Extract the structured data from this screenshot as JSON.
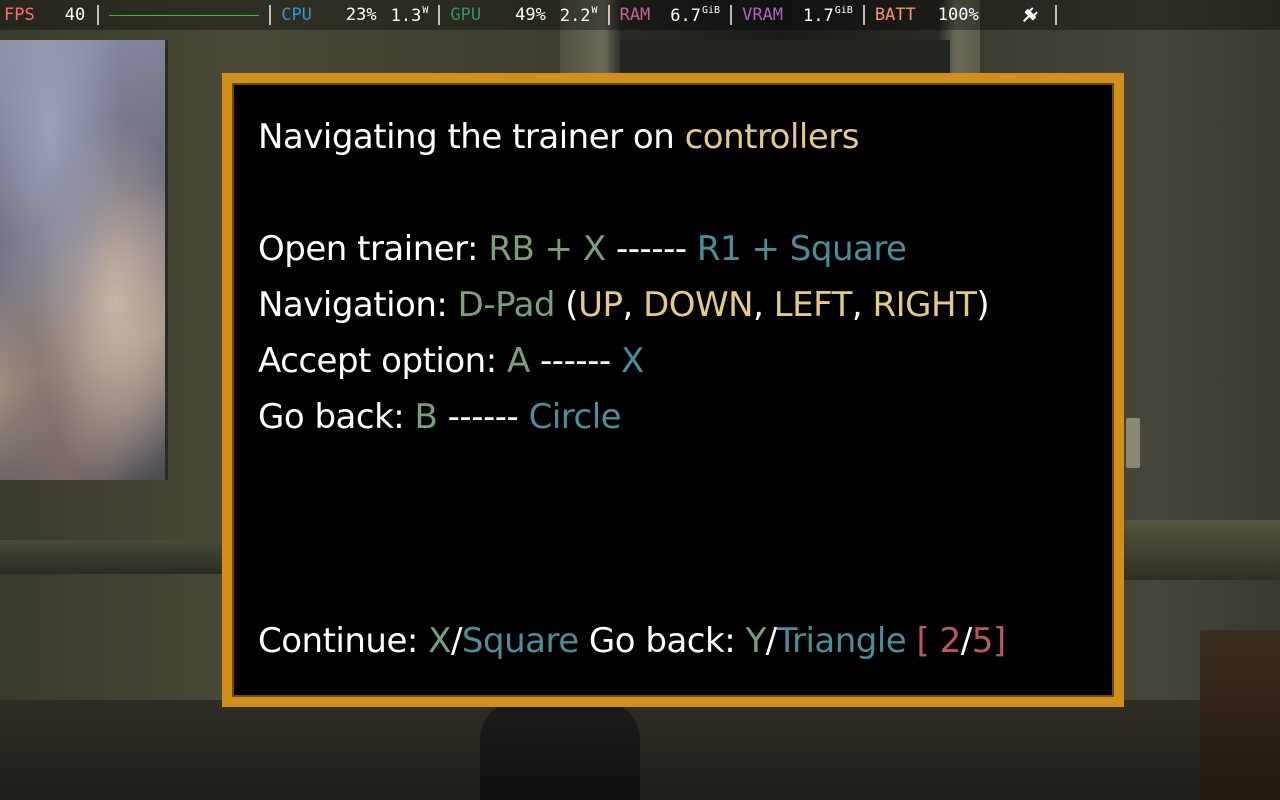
{
  "overlay": {
    "fps_label": "FPS",
    "fps_value": "40",
    "cpu_label": "CPU",
    "cpu_load": "23%",
    "cpu_power": "1.3",
    "cpu_power_unit": "W",
    "gpu_label": "GPU",
    "gpu_load": "49%",
    "gpu_power": "2.2",
    "gpu_power_unit": "W",
    "ram_label": "RAM",
    "ram_value": "6.7",
    "ram_unit": "GiB",
    "vram_label": "VRAM",
    "vram_value": "1.7",
    "vram_unit": "GiB",
    "batt_label": "BATT",
    "batt_value": "100%",
    "colors": {
      "fps": "#ff6b6b",
      "cpu": "#2e97cb",
      "gpu": "#2e9762",
      "ram": "#c26693",
      "vram": "#ad64c1",
      "batt": "#ff9078",
      "graph": "#2fbf3a"
    },
    "charging_icon": "plug-icon"
  },
  "dialog": {
    "border_color": "#d1901b",
    "title_prefix": "Navigating the trainer on ",
    "title_highlight": "controllers",
    "lines": {
      "open_label": "Open trainer: ",
      "open_xbox": "RB + X",
      "open_sep": " ------ ",
      "open_ps": "R1 + Square",
      "nav_label": "Navigation: ",
      "nav_pad": "D-Pad",
      "nav_open": " (",
      "nav_up": "UP",
      "nav_comma1": ", ",
      "nav_down": "DOWN",
      "nav_comma2": ", ",
      "nav_left": "LEFT",
      "nav_comma3": ", ",
      "nav_right": "RIGHT",
      "nav_close": ")",
      "accept_label": "Accept option: ",
      "accept_xbox": "A",
      "accept_sep": " ------ ",
      "accept_ps": "X",
      "back_label": "Go back: ",
      "back_xbox": "B",
      "back_sep": " ------ ",
      "back_ps": "Circle"
    },
    "footer": {
      "continue_label": "Continue: ",
      "continue_xbox": "X",
      "slash1": "/",
      "continue_ps": "Square",
      "back_label": " Go back: ",
      "back_xbox": "Y",
      "slash2": "/",
      "back_ps": "Triangle",
      "bracket_open": " [ ",
      "page_current": "2",
      "page_slash": "/",
      "page_total": "5",
      "bracket_close": "]"
    },
    "colors": {
      "highlight": "#e3c98a",
      "xbox": "#7aa07a",
      "playstation": "#4f8c9a",
      "page": "#b95a57"
    }
  }
}
